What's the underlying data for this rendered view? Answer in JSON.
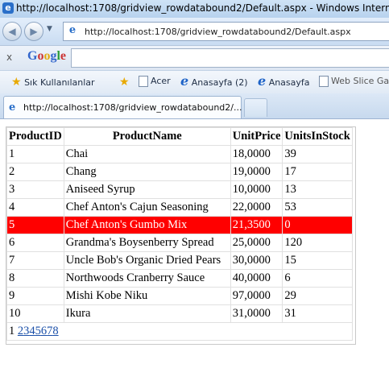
{
  "window": {
    "title": "http://localhost:1708/gridview_rowdatabound2/Default.aspx - Windows Internet Explorer"
  },
  "navigation": {
    "address": "http://localhost:1708/gridview_rowdatabound2/Default.aspx"
  },
  "google_toolbar": {
    "close": "x",
    "logo_letters": [
      "G",
      "o",
      "o",
      "g",
      "l",
      "e"
    ],
    "search_value": ""
  },
  "favorites": {
    "items": [
      {
        "label": "Sık Kullanılanlar",
        "icon": "star-icon"
      },
      {
        "label": "Acer",
        "icon": "ie-page-icon"
      },
      {
        "label": "Anasayfa (2)",
        "icon": "ie-icon"
      },
      {
        "label": "Anasayfa",
        "icon": "ie-icon"
      },
      {
        "label": "Web Slice Gal",
        "icon": "page-icon"
      }
    ]
  },
  "tabs": {
    "active_label": "http://localhost:1708/gridview_rowdatabound2/..."
  },
  "grid": {
    "headers": [
      "ProductID",
      "ProductName",
      "UnitPrice",
      "UnitsInStock"
    ],
    "rows": [
      [
        "1",
        "Chai",
        "18,0000",
        "39"
      ],
      [
        "2",
        "Chang",
        "19,0000",
        "17"
      ],
      [
        "3",
        "Aniseed Syrup",
        "10,0000",
        "13"
      ],
      [
        "4",
        "Chef Anton's Cajun Seasoning",
        "22,0000",
        "53"
      ],
      [
        "5",
        "Chef Anton's Gumbo Mix",
        "21,3500",
        "0"
      ],
      [
        "6",
        "Grandma's Boysenberry Spread",
        "25,0000",
        "120"
      ],
      [
        "7",
        "Uncle Bob's Organic Dried Pears",
        "30,0000",
        "15"
      ],
      [
        "8",
        "Northwoods Cranberry Sauce",
        "40,0000",
        "6"
      ],
      [
        "9",
        "Mishi Kobe Niku",
        "97,0000",
        "29"
      ],
      [
        "10",
        "Ikura",
        "31,0000",
        "31"
      ]
    ],
    "highlight_row_index": 4,
    "highlight_color": "#ff0000",
    "pager": {
      "current": "1",
      "pages": [
        "2",
        "3",
        "4",
        "5",
        "6",
        "7",
        "8"
      ]
    }
  }
}
